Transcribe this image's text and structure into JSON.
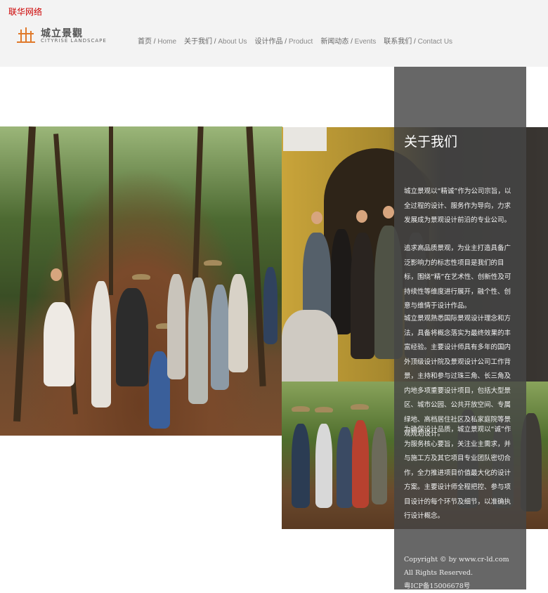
{
  "header": {
    "top_link": "联华网络",
    "logo": {
      "cn": "城立景觀",
      "en": "CITYRISE LANDSCAPE",
      "accent": "#e07a2b"
    },
    "nav": [
      {
        "cn": "首页",
        "en": "Home"
      },
      {
        "cn": "关于我们",
        "en": "About Us"
      },
      {
        "cn": "设计作品",
        "en": "Product"
      },
      {
        "cn": "新闻动态",
        "en": "Events"
      },
      {
        "cn": "联系我们",
        "en": "Contact Us"
      }
    ]
  },
  "about": {
    "title": "关于我们",
    "paragraphs": [
      "城立景观以“精诚”作为公司宗旨，以全过程的设计、服务作为导向，力求发展成为景观设计前沿的专业公司。",
      "追求高品质景观，为业主打造具备广泛影响力的标志性项目是我们的目标，围绕“精”在艺术性、创新性及可持续性等维度进行展开，融个性、创意与维情于设计作品。",
      "城立景观熟悉国际景观设计理念和方法，具备将概念落实为最终效果的丰富经验。主要设计师具有多年的国内外顶级设计院及景观设计公司工作背景，主持和参与过珠三角、长三角及内地多项重要设计项目，包括大型景区、城市公园、公共开放空间、专属绿地、高档居住社区及私家庭院等景观规划设计。",
      "为确保设计品质，城立景观以“诚”作为服务核心要旨，关注业主需求，并与施工方及其它项目专业团队密切合作，全力推进项目价值最大化的设计方案。主要设计师全程把控、参与项目设计的每个环节及细节，以准确执行设计概念。"
    ],
    "copyright": "Copyright © by www.cr-ld.com All Rights Reserved.",
    "icp": "粤ICP备15006678号"
  }
}
